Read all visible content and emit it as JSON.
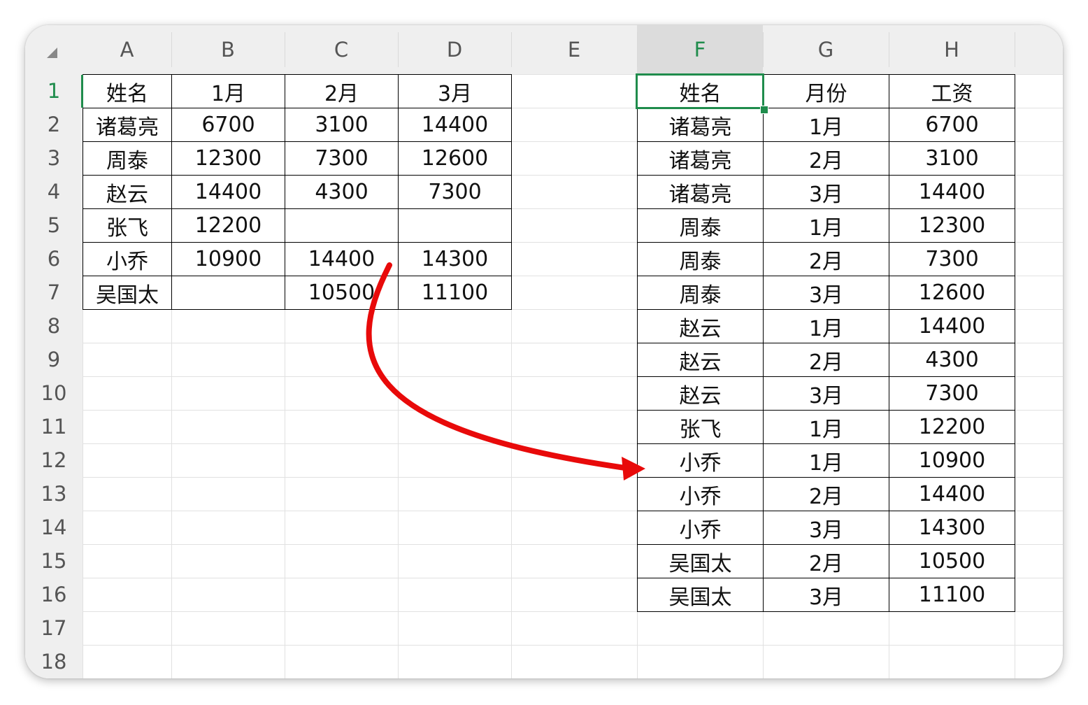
{
  "columns": [
    "A",
    "B",
    "C",
    "D",
    "E",
    "F",
    "G",
    "H"
  ],
  "rows": [
    "1",
    "2",
    "3",
    "4",
    "5",
    "6",
    "7",
    "8",
    "9",
    "10",
    "11",
    "12",
    "13",
    "14",
    "15",
    "16",
    "17",
    "18"
  ],
  "selected_column": "F",
  "selected_row": "1",
  "source_table": {
    "header": [
      "姓名",
      "1月",
      "2月",
      "3月"
    ],
    "rows": [
      [
        "诸葛亮",
        "6700",
        "3100",
        "14400"
      ],
      [
        "周泰",
        "12300",
        "7300",
        "12600"
      ],
      [
        "赵云",
        "14400",
        "4300",
        "7300"
      ],
      [
        "张飞",
        "12200",
        "",
        ""
      ],
      [
        "小乔",
        "10900",
        "14400",
        "14300"
      ],
      [
        "吴国太",
        "",
        "10500",
        "11100"
      ]
    ]
  },
  "result_table": {
    "header": [
      "姓名",
      "月份",
      "工资"
    ],
    "rows": [
      [
        "诸葛亮",
        "1月",
        "6700"
      ],
      [
        "诸葛亮",
        "2月",
        "3100"
      ],
      [
        "诸葛亮",
        "3月",
        "14400"
      ],
      [
        "周泰",
        "1月",
        "12300"
      ],
      [
        "周泰",
        "2月",
        "7300"
      ],
      [
        "周泰",
        "3月",
        "12600"
      ],
      [
        "赵云",
        "1月",
        "14400"
      ],
      [
        "赵云",
        "2月",
        "4300"
      ],
      [
        "赵云",
        "3月",
        "7300"
      ],
      [
        "张飞",
        "1月",
        "12200"
      ],
      [
        "小乔",
        "1月",
        "10900"
      ],
      [
        "小乔",
        "2月",
        "14400"
      ],
      [
        "小乔",
        "3月",
        "14300"
      ],
      [
        "吴国太",
        "2月",
        "10500"
      ],
      [
        "吴国太",
        "3月",
        "11100"
      ]
    ]
  },
  "colors": {
    "accent": "#1f8c4c",
    "arrow": "#e80a0a",
    "header_bg": "#efefef"
  },
  "icons": {
    "corner": "select-all-triangle-icon",
    "annotation": "red-curved-arrow-icon"
  }
}
